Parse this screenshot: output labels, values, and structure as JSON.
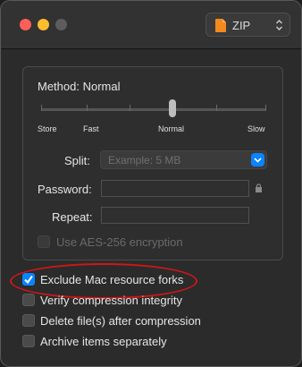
{
  "window": {
    "format_selector": {
      "value": "ZIP",
      "icon": "zip-file-icon"
    }
  },
  "compression": {
    "method_label": "Method: Normal",
    "slider_value": "Normal",
    "slider_labels": {
      "store": "Store",
      "fast": "Fast",
      "normal": "Normal",
      "slow": "Slow"
    },
    "split_label": "Split:",
    "split_placeholder": "Example: 5 MB",
    "password_label": "Password:",
    "password_value": "",
    "repeat_label": "Repeat:",
    "repeat_value": "",
    "aes_label": "Use AES-256 encryption",
    "aes_checked": false,
    "aes_enabled": false
  },
  "options": [
    {
      "label": "Exclude Mac resource forks",
      "checked": true
    },
    {
      "label": "Verify compression integrity",
      "checked": false
    },
    {
      "label": "Delete file(s) after compression",
      "checked": false
    },
    {
      "label": "Archive items separately",
      "checked": false
    }
  ],
  "colors": {
    "accent": "#0a84ff",
    "highlight": "#d01616"
  }
}
